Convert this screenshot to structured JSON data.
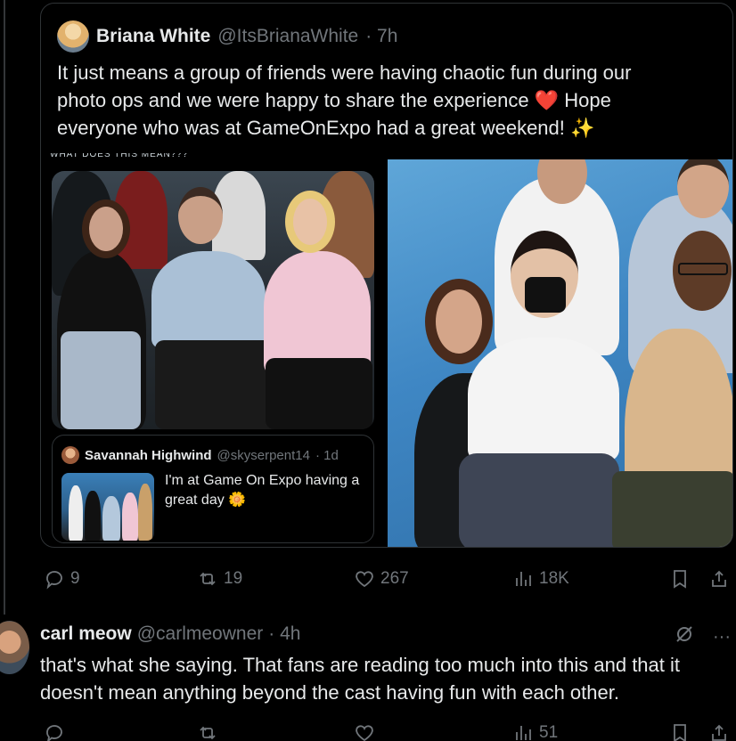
{
  "quoted_post": {
    "author_name": "Briana White",
    "author_handle": "@ItsBrianaWhite",
    "time": "· 7h",
    "text_1": "It just means a group of friends were having chaotic fun during our photo ops and we were happy to share the experience ",
    "heart_emoji": "❤️",
    "text_2": " Hope everyone who was at GameOnExpo had a great weekend! ",
    "sparkle_emoji": "✨",
    "cut_text": "WHAT DOES THIS MEAN???",
    "inner_quote": {
      "author_name": "Savannah Highwind",
      "author_handle": "@skyserpent14",
      "time": "· 1d",
      "text": "I'm at Game On Expo having a great day ",
      "emoji": "🌼"
    },
    "actions": {
      "replies": "9",
      "reposts": "19",
      "likes": "267",
      "views": "18K"
    }
  },
  "reply_post": {
    "author_name": "carl meow",
    "author_handle": "@carlmeowner",
    "time": "· 4h",
    "more": "···",
    "text": "that's what she saying. That fans are reading too much into this and that it doesn't mean anything beyond the cast having fun with each other.",
    "actions": {
      "views": "51"
    }
  },
  "colors": {
    "background": "#000000",
    "text": "#e7e9ea",
    "muted": "#71767b",
    "border": "#2f3336"
  }
}
